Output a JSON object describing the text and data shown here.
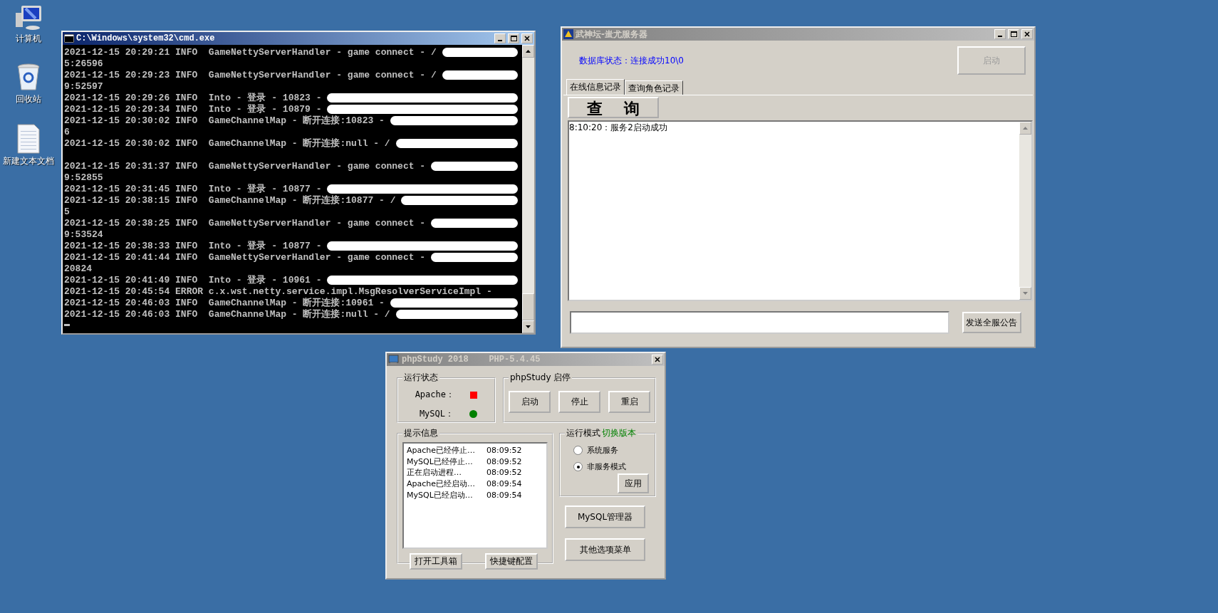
{
  "desktop_icons": [
    {
      "label": "计算机",
      "kind": "computer"
    },
    {
      "label": "回收站",
      "kind": "recycle-bin"
    },
    {
      "label": "新建文本文档",
      "kind": "document"
    }
  ],
  "console": {
    "title": "C:\\Windows\\system32\\cmd.exe",
    "lines": [
      {
        "text": "2021-12-15 20:29:21 INFO  GameNettyServerHandler - game connect - /",
        "redacted": true
      },
      {
        "text": "5:26596",
        "redacted": false
      },
      {
        "text": "2021-12-15 20:29:23 INFO  GameNettyServerHandler - game connect - /",
        "redacted": true
      },
      {
        "text": "9:52597",
        "redacted": false
      },
      {
        "text": "2021-12-15 20:29:26 INFO  Into - 登录 - 10823 -",
        "redacted": true
      },
      {
        "text": "2021-12-15 20:29:34 INFO  Into - 登录 - 10879 -",
        "redacted": true
      },
      {
        "text": "2021-12-15 20:30:02 INFO  GameChannelMap - 断开连接:10823 -",
        "redacted": true
      },
      {
        "text": "6",
        "redacted": false
      },
      {
        "text": "2021-12-15 20:30:02 INFO  GameChannelMap - 断开连接:null - /",
        "redacted": true,
        "blank_after": true
      },
      {
        "text": "2021-12-15 20:31:37 INFO  GameNettyServerHandler - game connect -",
        "redacted": true
      },
      {
        "text": "9:52855",
        "redacted": false
      },
      {
        "text": "2021-12-15 20:31:45 INFO  Into - 登录 - 10877 -",
        "redacted": true
      },
      {
        "text": "2021-12-15 20:38:15 INFO  GameChannelMap - 断开连接:10877 - /",
        "redacted": true
      },
      {
        "text": "5",
        "redacted": false
      },
      {
        "text": "2021-12-15 20:38:25 INFO  GameNettyServerHandler - game connect -",
        "redacted": true
      },
      {
        "text": "9:53524",
        "redacted": false
      },
      {
        "text": "2021-12-15 20:38:33 INFO  Into - 登录 - 10877 -",
        "redacted": true
      },
      {
        "text": "2021-12-15 20:41:44 INFO  GameNettyServerHandler - game connect -",
        "redacted": true
      },
      {
        "text": "20824",
        "redacted": false
      },
      {
        "text": "2021-12-15 20:41:49 INFO  Into - 登录 - 10961 -",
        "redacted": true
      },
      {
        "text": "2021-12-15 20:45:54 ERROR c.x.wst.netty.service.impl.MsgResolverServiceImpl -",
        "redacted": false
      },
      {
        "text": "2021-12-15 20:46:03 INFO  GameChannelMap - 断开连接:10961 -",
        "redacted": true
      },
      {
        "text": "2021-12-15 20:46:03 INFO  GameChannelMap - 断开连接:null - /",
        "redacted": true
      }
    ]
  },
  "server": {
    "title": "武神坛-蚩尤服务器",
    "db_status": "数据库状态：连接成功10\\0",
    "start_button": {
      "label": "启动",
      "disabled": true
    },
    "tabs": [
      {
        "label": "在线信息记录",
        "selected": true
      },
      {
        "label": "查询角色记录",
        "selected": false
      }
    ],
    "query_button": "查    询",
    "log": [
      "8:10:20：服务2启动成功"
    ],
    "send_button": "发送全服公告"
  },
  "phpstudy": {
    "title": "phpStudy 2018    PHP-5.4.45",
    "status_group": "运行状态",
    "services": [
      {
        "name": "Apache：",
        "kind": "square",
        "color": "#ff0000"
      },
      {
        "name": "MySQL：",
        "kind": "circle",
        "color": "#008000"
      }
    ],
    "control_group": "phpStudy 启停",
    "control_buttons": [
      "启动",
      "停止",
      "重启"
    ],
    "info_group": "提示信息",
    "messages": [
      {
        "text": "Apache已经停止…",
        "time": "08:09:52"
      },
      {
        "text": "MySQL已经停止…",
        "time": "08:09:52"
      },
      {
        "text": "正在启动进程…",
        "time": "08:09:52"
      },
      {
        "text": "Apache已经启动…",
        "time": "08:09:54"
      },
      {
        "text": "MySQL已经启动…",
        "time": "08:09:54"
      }
    ],
    "info_buttons": [
      "打开工具箱",
      "快捷键配置"
    ],
    "mode_group": "运行模式",
    "switch_link": "切换版本",
    "modes": [
      {
        "label": "系统服务",
        "selected": false
      },
      {
        "label": "非服务模式",
        "selected": true
      }
    ],
    "apply_button": "应用",
    "side_buttons": [
      "MySQL管理器",
      "其他选项菜单"
    ]
  }
}
